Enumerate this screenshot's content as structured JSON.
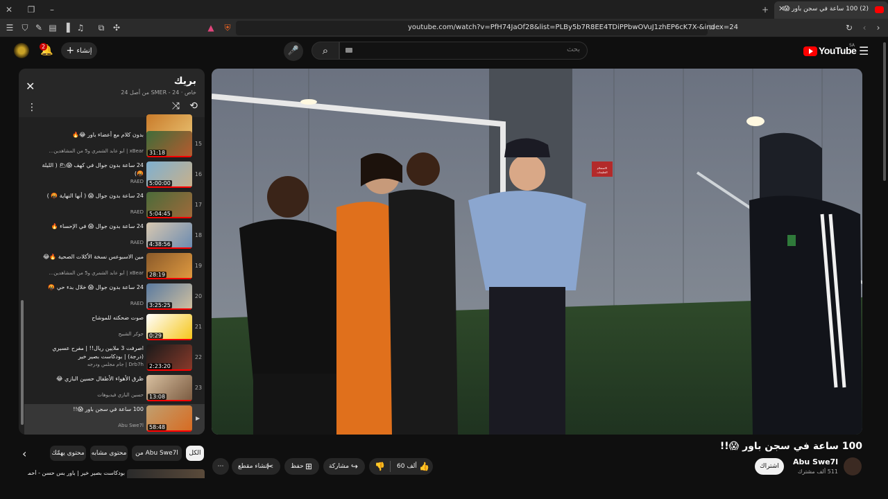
{
  "browser": {
    "tab_title": "(2) 100 ساعة في سجن باور 😱",
    "url": "youtube.com/watch?v=PfH74JaOf28&list=PLBy5b7R8EE4TDiPPbwOVuJ1zhEP6cK7X-&index=24"
  },
  "header": {
    "logo_text": "YouTube",
    "logo_region": "SA",
    "search_placeholder": "بحث",
    "create_label": "إنشاء",
    "notifications_count": "2"
  },
  "playlist": {
    "title": "بريك",
    "subtitle": "خاص · SMER - 24 من أصل 24",
    "items": [
      {
        "index": "",
        "title": "",
        "channel": "",
        "duration": "50:16",
        "thumb_colors": [
          "#c97b2a",
          "#e8c070"
        ]
      },
      {
        "index": "15",
        "title": "بدون كلام مع أعضاء باور 😂🔥",
        "channel": "xBear | أبو عابد الشمري و5 من المشاهدين…",
        "duration": "31:18",
        "thumb_colors": [
          "#3f6d3a",
          "#b85a2e"
        ]
      },
      {
        "index": "16",
        "title": "24 ساعة بدون جوال في كهف 😱🌥 ( الليلة 🤬)",
        "channel": "RAED",
        "duration": "5:00:00",
        "thumb_colors": [
          "#7fb0d0",
          "#c8b08a"
        ]
      },
      {
        "index": "17",
        "title": "24 ساعة بدون جوال 😱 ( أنها النهاية 🤬 )",
        "channel": "RAED",
        "duration": "5:04:45",
        "thumb_colors": [
          "#4b6b3a",
          "#a06a3a"
        ]
      },
      {
        "index": "18",
        "title": "24 ساعة بدون جوال 😱 في الإحساء 🔥",
        "channel": "RAED",
        "duration": "4:38:56",
        "thumb_colors": [
          "#d8c8b0",
          "#6a8ab0"
        ]
      },
      {
        "index": "19",
        "title": "مين الاسبوعس نسخة الأكلات الصحية 🔥😂",
        "channel": "xBear | أبو عابد الشمري و5 من المشاهدين…",
        "duration": "28:19",
        "thumb_colors": [
          "#8a5a2a",
          "#e09a40"
        ]
      },
      {
        "index": "20",
        "title": "24 ساعة بدون جوال 😱 خلال بدء حي 🤬",
        "channel": "RAED",
        "duration": "3:25:25",
        "thumb_colors": [
          "#5a7aa0",
          "#d0c0a0"
        ]
      },
      {
        "index": "21",
        "title": "صوت ضحكته للموشاح",
        "channel": "جوكر الشبيح",
        "duration": "0:29",
        "thumb_colors": [
          "#ffffff",
          "#f5c518"
        ]
      },
      {
        "index": "22",
        "title": "اصرفت 3 ملايين ريال!! | مفرح عسيري (درجة) | بودكاست بصير خير",
        "channel": "Drb7h | جام مجلس ودرجه",
        "duration": "2:23:20",
        "thumb_colors": [
          "#1a1a1a",
          "#8a3a2a"
        ]
      },
      {
        "index": "23",
        "title": "ظرق الأهواء الأطفال حسين البازي 😂",
        "channel": "حسين البازي فيديوهات",
        "duration": "13:08",
        "thumb_colors": [
          "#d8c0a0",
          "#7a5a40"
        ]
      },
      {
        "index": "",
        "title": "100 ساعة في سجن باور 😱!!",
        "channel": "Abu Swe7l",
        "duration": "58:48",
        "thumb_colors": [
          "#c0a070",
          "#d86a20"
        ],
        "active": true
      }
    ]
  },
  "video": {
    "title": "100 ساعة في سجن باور 😱!!",
    "scene": {
      "sign_1": "الاستعلام",
      "sign_2": "التعليمات"
    }
  },
  "channel": {
    "name": "Abu Swe7l",
    "subscribers": "511 ألف مشترك",
    "subscribe_label": "اشتراك"
  },
  "actions": {
    "likes": "60 ألف",
    "share": "مشاركة",
    "save": "حفظ",
    "clip": "إنشاء مقطع"
  },
  "chips": {
    "all": "الكل",
    "from_channel": "من Abu Swe7l",
    "similar": "محتوى مشابه",
    "recommended": "محتوى يهمّك"
  },
  "next_up": {
    "title": "بودكاست بصير خير | باور بس حسن - أحمد"
  },
  "colors": {
    "background": "#0f0f0f",
    "accent": "#ff0000",
    "panel": "#212121",
    "chip": "#272727"
  }
}
